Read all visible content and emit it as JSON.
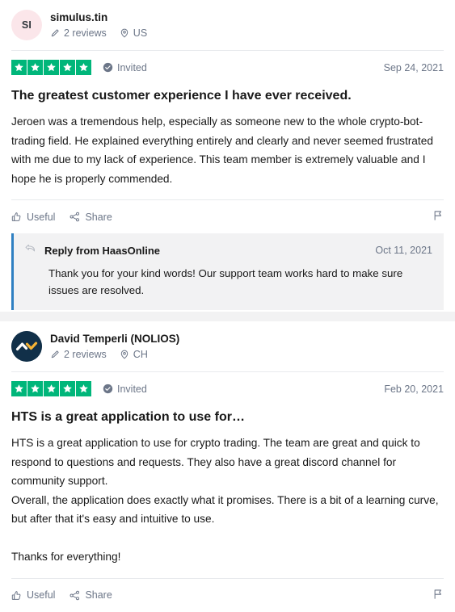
{
  "colors": {
    "star_green": "#00b67a",
    "reply_accent": "#2f80c2",
    "muted_text": "#6c7688",
    "avatar_pink": "#fbe6ea",
    "avatar_navy": "#113049",
    "logo_yellow": "#f5b335"
  },
  "reviews": [
    {
      "avatar_initials": "SI",
      "avatar_type": "initials",
      "consumer_name": "simulus.tin",
      "reviews_count": "2 reviews",
      "location": "US",
      "rating": 5,
      "verification_label": "Invited",
      "date": "Sep 24, 2021",
      "title": "The greatest customer experience I have ever received.",
      "text": "Jeroen was a tremendous help, especially as someone new to the whole crypto-bot-trading field. He explained everything entirely and clearly and never seemed frustrated with me due to my lack of experience. This team member is extremely valuable and I hope he is properly commended.",
      "useful_label": "Useful",
      "share_label": "Share",
      "reply": {
        "title": "Reply from HaasOnline",
        "date": "Oct 11, 2021",
        "text": "Thank you for your kind words! Our support team works hard to make sure issues are resolved."
      }
    },
    {
      "avatar_initials": "",
      "avatar_type": "logo",
      "consumer_name": "David Temperli (NOLIOS)",
      "reviews_count": "2 reviews",
      "location": "CH",
      "rating": 5,
      "verification_label": "Invited",
      "date": "Feb 20, 2021",
      "title": "HTS is a great application to use for…",
      "text": "HTS is a great application to use for crypto trading. The team are great and quick to respond to questions and requests. They also have a great discord channel for community support.\nOverall, the application does exactly what it promises. There is a bit of a learning curve, but after that it's easy and intuitive to use.\n\nThanks for everything!",
      "useful_label": "Useful",
      "share_label": "Share",
      "reply": null
    }
  ],
  "icons": {
    "pencil": "pencil-icon",
    "location": "location-pin-icon",
    "verified": "verified-check-icon",
    "thumbs_up": "thumbs-up-icon",
    "share": "share-icon",
    "flag": "flag-icon",
    "reply": "reply-arrow-icon"
  }
}
